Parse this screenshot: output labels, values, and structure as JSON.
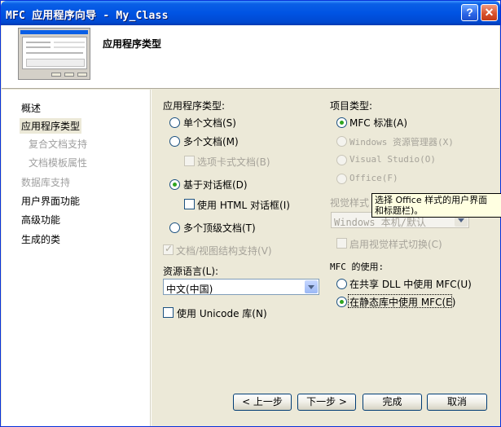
{
  "window": {
    "title": "MFC 应用程序向导 - My_Class",
    "help_label": "?",
    "close_label": "✕"
  },
  "header": {
    "title": "应用程序类型"
  },
  "nav": {
    "items": [
      {
        "label": "概述",
        "state": "normal"
      },
      {
        "label": "应用程序类型",
        "state": "selected"
      },
      {
        "label": "复合文档支持",
        "state": "disabled"
      },
      {
        "label": "文档模板属性",
        "state": "disabled"
      },
      {
        "label": "数据库支持",
        "state": "disabled"
      },
      {
        "label": "用户界面功能",
        "state": "normal"
      },
      {
        "label": "高级功能",
        "state": "normal"
      },
      {
        "label": "生成的类",
        "state": "normal"
      }
    ]
  },
  "app_type": {
    "heading": "应用程序类型:",
    "options": [
      {
        "label": "单个文档(S)",
        "checked": false
      },
      {
        "label": "多个文档(M)",
        "checked": false
      },
      {
        "label": "基于对话框(D)",
        "checked": true
      },
      {
        "label": "多个顶级文档(T)",
        "checked": false
      }
    ],
    "tabbed_docs": {
      "label": "选项卡式文档(B)",
      "checked": false,
      "enabled": false
    },
    "html_dialog": {
      "label": "使用 HTML 对话框(I)",
      "checked": false
    },
    "doc_view": {
      "label": "文档/视图结构支持(V)",
      "checked": true,
      "enabled": false
    }
  },
  "resource_language": {
    "label": "资源语言(L):",
    "value": "中文(中国)"
  },
  "unicode": {
    "label": "使用 Unicode 库(N)",
    "checked": false
  },
  "project_type": {
    "heading": "项目类型:",
    "options": [
      {
        "label": "MFC 标准(A)",
        "checked": true,
        "enabled": true
      },
      {
        "label": "Windows 资源管理器(X)",
        "checked": false,
        "enabled": false
      },
      {
        "label": "Visual Studio(O)",
        "checked": false,
        "enabled": false
      },
      {
        "label": "Office(F)",
        "checked": false,
        "enabled": false
      }
    ]
  },
  "visual_style": {
    "label": "视觉样式",
    "value": "Windows 本机/默认",
    "toggle_label": "启用视觉样式切换(C)"
  },
  "tooltip": {
    "line1": "选择 Office 样式的用户界面",
    "line2": "和标题栏)。"
  },
  "mfc_use": {
    "heading": "MFC 的使用:",
    "options": [
      {
        "label": "在共享 DLL 中使用 MFC(U)",
        "checked": false
      },
      {
        "label": "在静态库中使用 MFC(E)",
        "checked": true
      }
    ]
  },
  "footer": {
    "prev": "< 上一步",
    "next": "下一步 >",
    "finish": "完成",
    "cancel": "取消"
  }
}
